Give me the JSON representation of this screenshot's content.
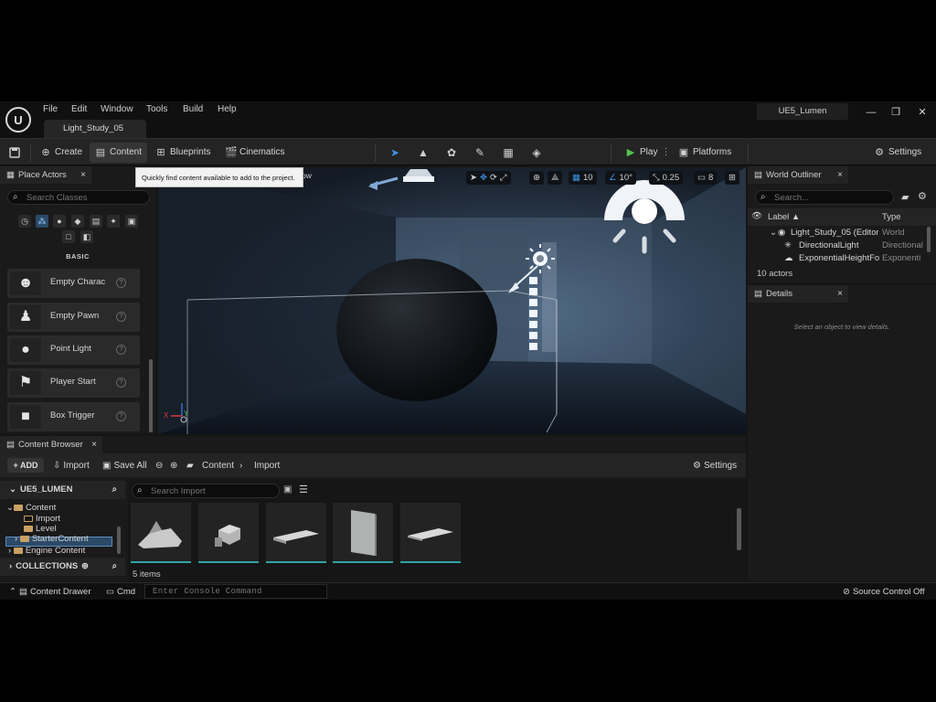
{
  "menubar": {
    "logo": "U",
    "items": [
      "File",
      "Edit",
      "Window",
      "Tools",
      "Build",
      "Help"
    ],
    "doc_tab": "Light_Study_05",
    "project": "UE5_Lumen",
    "window_buttons": [
      "—",
      "❐",
      "✕"
    ]
  },
  "toolbar": {
    "create": "Create",
    "content": "Content",
    "blueprints": "Blueprints",
    "cinematics": "Cinematics",
    "play": "Play",
    "platforms": "Platforms",
    "settings": "Settings"
  },
  "place_actors": {
    "tab": "Place Actors",
    "search_placeholder": "Search Classes",
    "category_label": "BASIC",
    "items": [
      {
        "label": "Empty Charac",
        "icon": "character-icon"
      },
      {
        "label": "Empty Pawn",
        "icon": "pawn-icon"
      },
      {
        "label": "Point Light",
        "icon": "bulb-icon"
      },
      {
        "label": "Player Start",
        "icon": "flag-icon"
      },
      {
        "label": "Box Trigger",
        "icon": "cube-icon"
      }
    ],
    "help_glyph": "?"
  },
  "viewport": {
    "tooltip": "Quickly find content available to add to the project.",
    "show_text": "ow",
    "grid_snap": "10",
    "rotation_snap": "10°",
    "scale_snap": "0.25",
    "camera_speed": "8",
    "axis_labels": {
      "x": "X",
      "y": "Y"
    }
  },
  "outliner": {
    "tab": "World Outliner",
    "search_placeholder": "Search...",
    "col_label": "Label ▲",
    "col_type": "Type",
    "rows": [
      {
        "label": "Light_Study_05 (Editor",
        "type": "World"
      },
      {
        "label": "DirectionalLight",
        "type": "Directional"
      },
      {
        "label": "ExponentialHeightFo",
        "type": "Exponenti"
      }
    ],
    "count": "10 actors"
  },
  "details": {
    "tab": "Details",
    "empty_text": "Select an object to view details."
  },
  "content_browser": {
    "tab": "Content Browser",
    "add": "+ ADD",
    "import": "Import",
    "save_all": "Save All",
    "path": [
      "Content",
      "Import"
    ],
    "settings": "Settings",
    "project_header": "UE5_LUMEN",
    "tree": [
      "Content",
      "Import",
      "Level",
      "StarterContent",
      "Engine Content"
    ],
    "collections_header": "COLLECTIONS",
    "search_placeholder": "Search Import",
    "item_count": "5 items"
  },
  "statusbar": {
    "content_drawer": "Content Drawer",
    "cmd": "Cmd",
    "console_placeholder": "Enter Console Command",
    "source_control": "Source Control Off"
  }
}
